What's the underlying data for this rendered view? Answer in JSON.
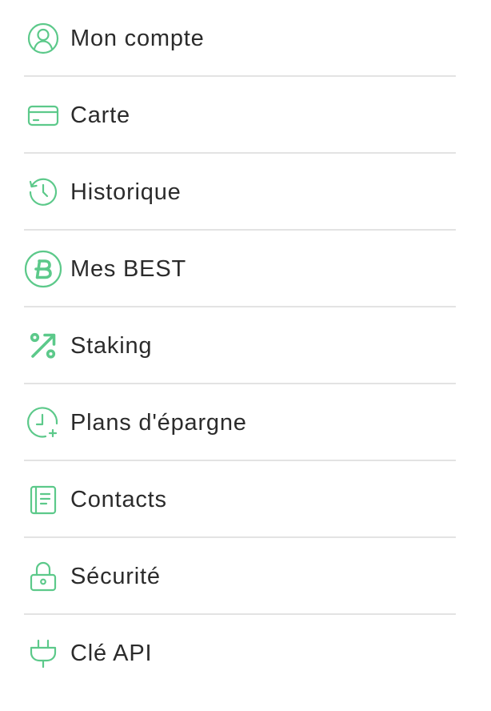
{
  "menu": {
    "accent_color": "#5cc98a",
    "items": [
      {
        "label": "Mon compte",
        "icon": "user-circle-icon"
      },
      {
        "label": "Carte",
        "icon": "credit-card-icon"
      },
      {
        "label": "Historique",
        "icon": "history-clock-icon"
      },
      {
        "label": "Mes BEST",
        "icon": "best-coin-icon"
      },
      {
        "label": "Staking",
        "icon": "percent-arrow-icon"
      },
      {
        "label": "Plans d'épargne",
        "icon": "clock-plus-icon"
      },
      {
        "label": "Contacts",
        "icon": "address-book-icon"
      },
      {
        "label": "Sécurité",
        "icon": "lock-icon"
      },
      {
        "label": "Clé API",
        "icon": "plug-icon"
      }
    ]
  }
}
